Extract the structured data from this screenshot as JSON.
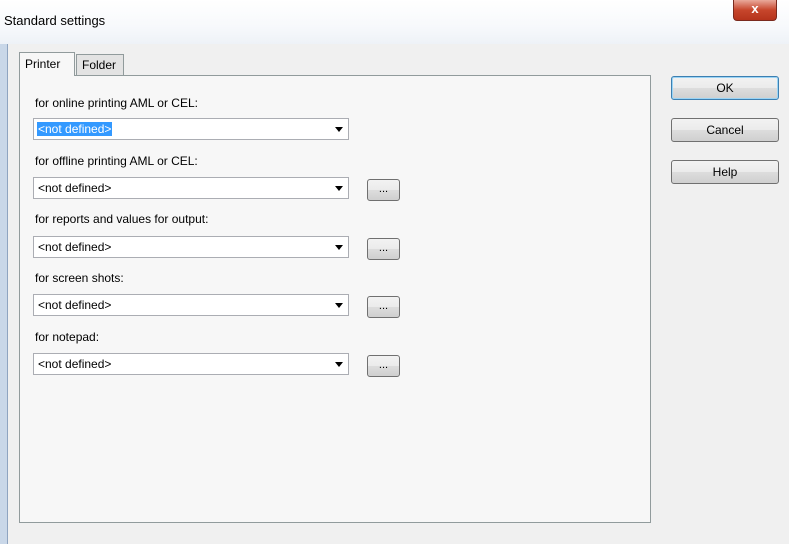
{
  "window": {
    "title": "Standard settings",
    "close_label": "x"
  },
  "tabs": [
    {
      "label": "Printer",
      "active": true
    },
    {
      "label": "Folder",
      "active": false
    }
  ],
  "fields": [
    {
      "label": "for online printing AML or CEL:",
      "value": "<not defined>",
      "has_browse": false,
      "focused": true
    },
    {
      "label": "for offline printing AML or CEL:",
      "value": "<not defined>",
      "has_browse": true,
      "browse_label": "..."
    },
    {
      "label": "for reports and values for output:",
      "value": "<not defined>",
      "has_browse": true,
      "browse_label": "..."
    },
    {
      "label": "for screen shots:",
      "value": "<not defined>",
      "has_browse": true,
      "browse_label": "..."
    },
    {
      "label": "for notepad:",
      "value": "<not defined>",
      "has_browse": true,
      "browse_label": "..."
    }
  ],
  "buttons": {
    "ok": "OK",
    "cancel": "Cancel",
    "help": "Help"
  },
  "colors": {
    "selection": "#3399ff",
    "close_button": "#c7462c"
  }
}
